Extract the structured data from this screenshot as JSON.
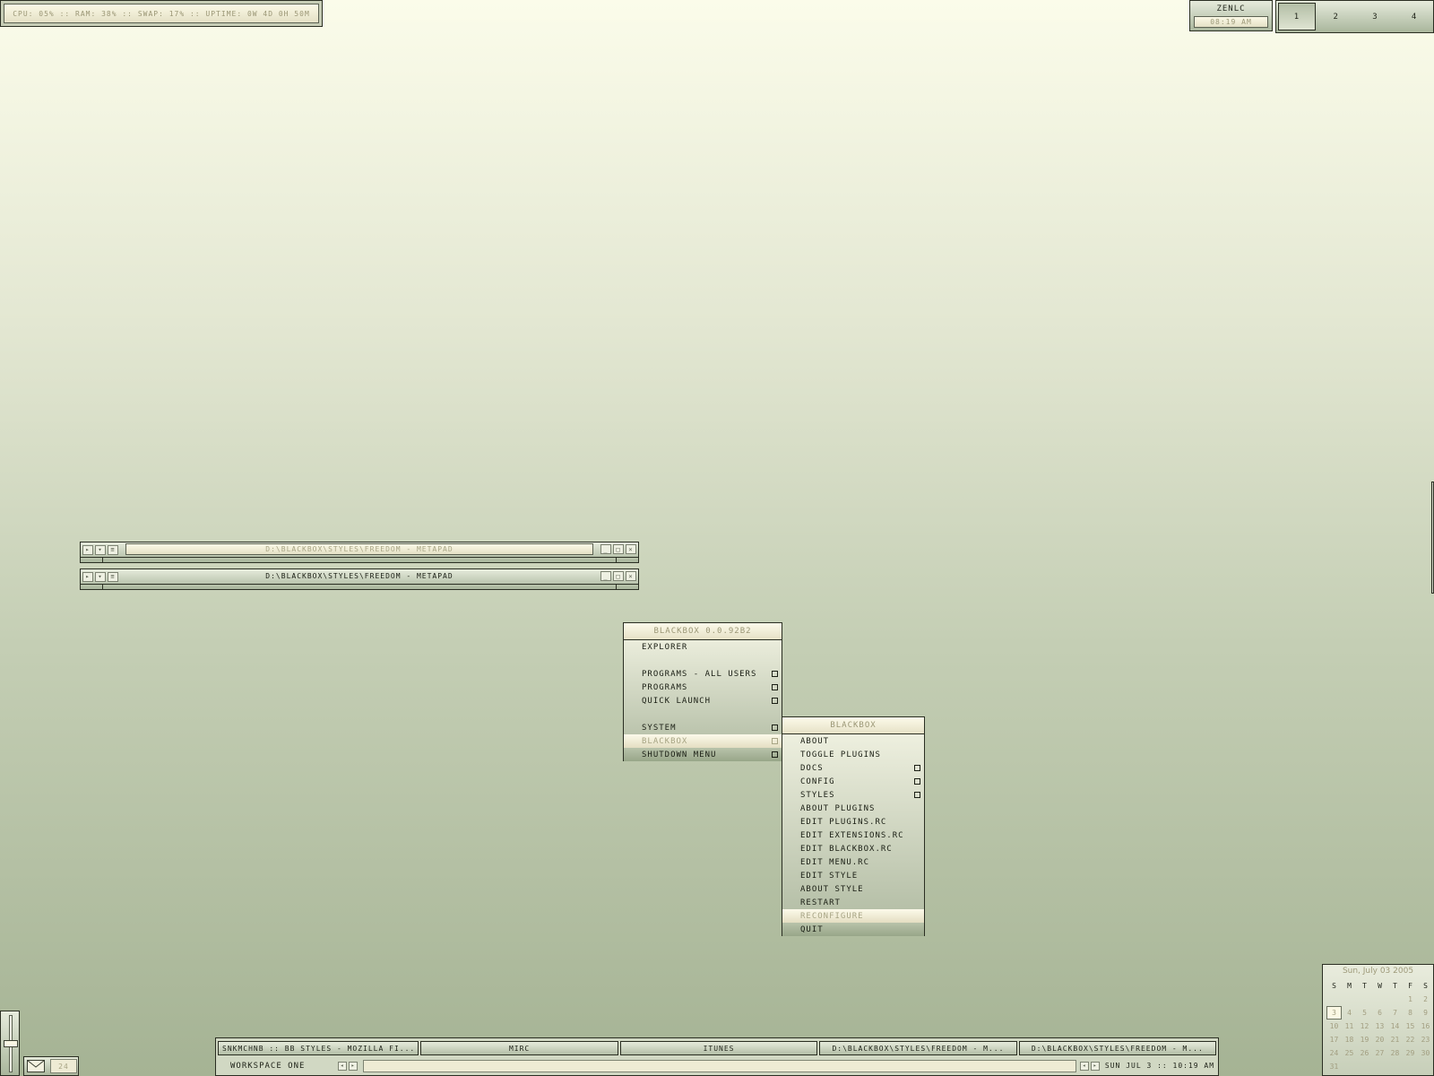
{
  "sysmon": {
    "text": "CPU: 05% :: RAM: 38% :: SWAP: 17% :: UPTIME: 0W 4D 0H 50M"
  },
  "clock": {
    "name": "ZENLC",
    "time": "08:19 AM"
  },
  "pager": {
    "workspaces": [
      "1",
      "2",
      "3",
      "4"
    ],
    "active": "1"
  },
  "windows": [
    {
      "title": "D:\\BLACKBOX\\STYLES\\FREEDOM - METAPAD",
      "state": "inactive"
    },
    {
      "title": "D:\\BLACKBOX\\STYLES\\FREEDOM - METAPAD",
      "state": "active"
    }
  ],
  "root_menu": {
    "title": "BLACKBOX 0.0.92B2",
    "items": [
      {
        "label": "EXPLORER",
        "submenu": false
      },
      {
        "label": "PROGRAMS - ALL USERS",
        "submenu": true
      },
      {
        "label": "PROGRAMS",
        "submenu": true
      },
      {
        "label": "QUICK LAUNCH",
        "submenu": true
      },
      {
        "label": "SYSTEM",
        "submenu": true
      },
      {
        "label": "BLACKBOX",
        "submenu": true,
        "highlighted": true
      },
      {
        "label": "SHUTDOWN MENU",
        "submenu": true
      }
    ]
  },
  "blackbox_menu": {
    "title": "BLACKBOX",
    "items": [
      {
        "label": "ABOUT",
        "submenu": false
      },
      {
        "label": "TOGGLE PLUGINS",
        "submenu": false
      },
      {
        "label": "DOCS",
        "submenu": true
      },
      {
        "label": "CONFIG",
        "submenu": true
      },
      {
        "label": "STYLES",
        "submenu": true
      },
      {
        "label": "ABOUT PLUGINS",
        "submenu": false
      },
      {
        "label": "EDIT PLUGINS.RC",
        "submenu": false
      },
      {
        "label": "EDIT EXTENSIONS.RC",
        "submenu": false
      },
      {
        "label": "EDIT BLACKBOX.RC",
        "submenu": false
      },
      {
        "label": "EDIT MENU.RC",
        "submenu": false
      },
      {
        "label": "EDIT STYLE",
        "submenu": false
      },
      {
        "label": "ABOUT STYLE",
        "submenu": false
      },
      {
        "label": "RESTART",
        "submenu": false
      },
      {
        "label": "RECONFIGURE",
        "submenu": false,
        "highlighted": true
      },
      {
        "label": "QUIT",
        "submenu": false
      }
    ]
  },
  "calendar": {
    "title": "Sun, July 03 2005",
    "weekdays": [
      "S",
      "M",
      "T",
      "W",
      "T",
      "F",
      "S"
    ],
    "days": [
      "",
      "",
      "",
      "",
      "",
      "1",
      "2",
      "3",
      "4",
      "5",
      "6",
      "7",
      "8",
      "9",
      "10",
      "11",
      "12",
      "13",
      "14",
      "15",
      "16",
      "17",
      "18",
      "19",
      "20",
      "21",
      "22",
      "23",
      "24",
      "25",
      "26",
      "27",
      "28",
      "29",
      "30",
      "31"
    ],
    "today": "3"
  },
  "mail": {
    "count": "24"
  },
  "taskbar": {
    "tasks": [
      "SNKMCHNB :: BB STYLES - MOZILLA FI...",
      "MIRC",
      "ITUNES",
      "D:\\BLACKBOX\\STYLES\\FREEDOM - M...",
      "D:\\BLACKBOX\\STYLES\\FREEDOM - M..."
    ],
    "workspace": "WORKSPACE ONE",
    "datetime": "SUN JUL 3 :: 10:19 AM"
  },
  "colors": {
    "bg_top": "#fbfcea",
    "bg_bottom": "#a5b394",
    "border": "#2a2e22",
    "highlight": "#fcfaea",
    "muted_text": "#9a9675"
  }
}
